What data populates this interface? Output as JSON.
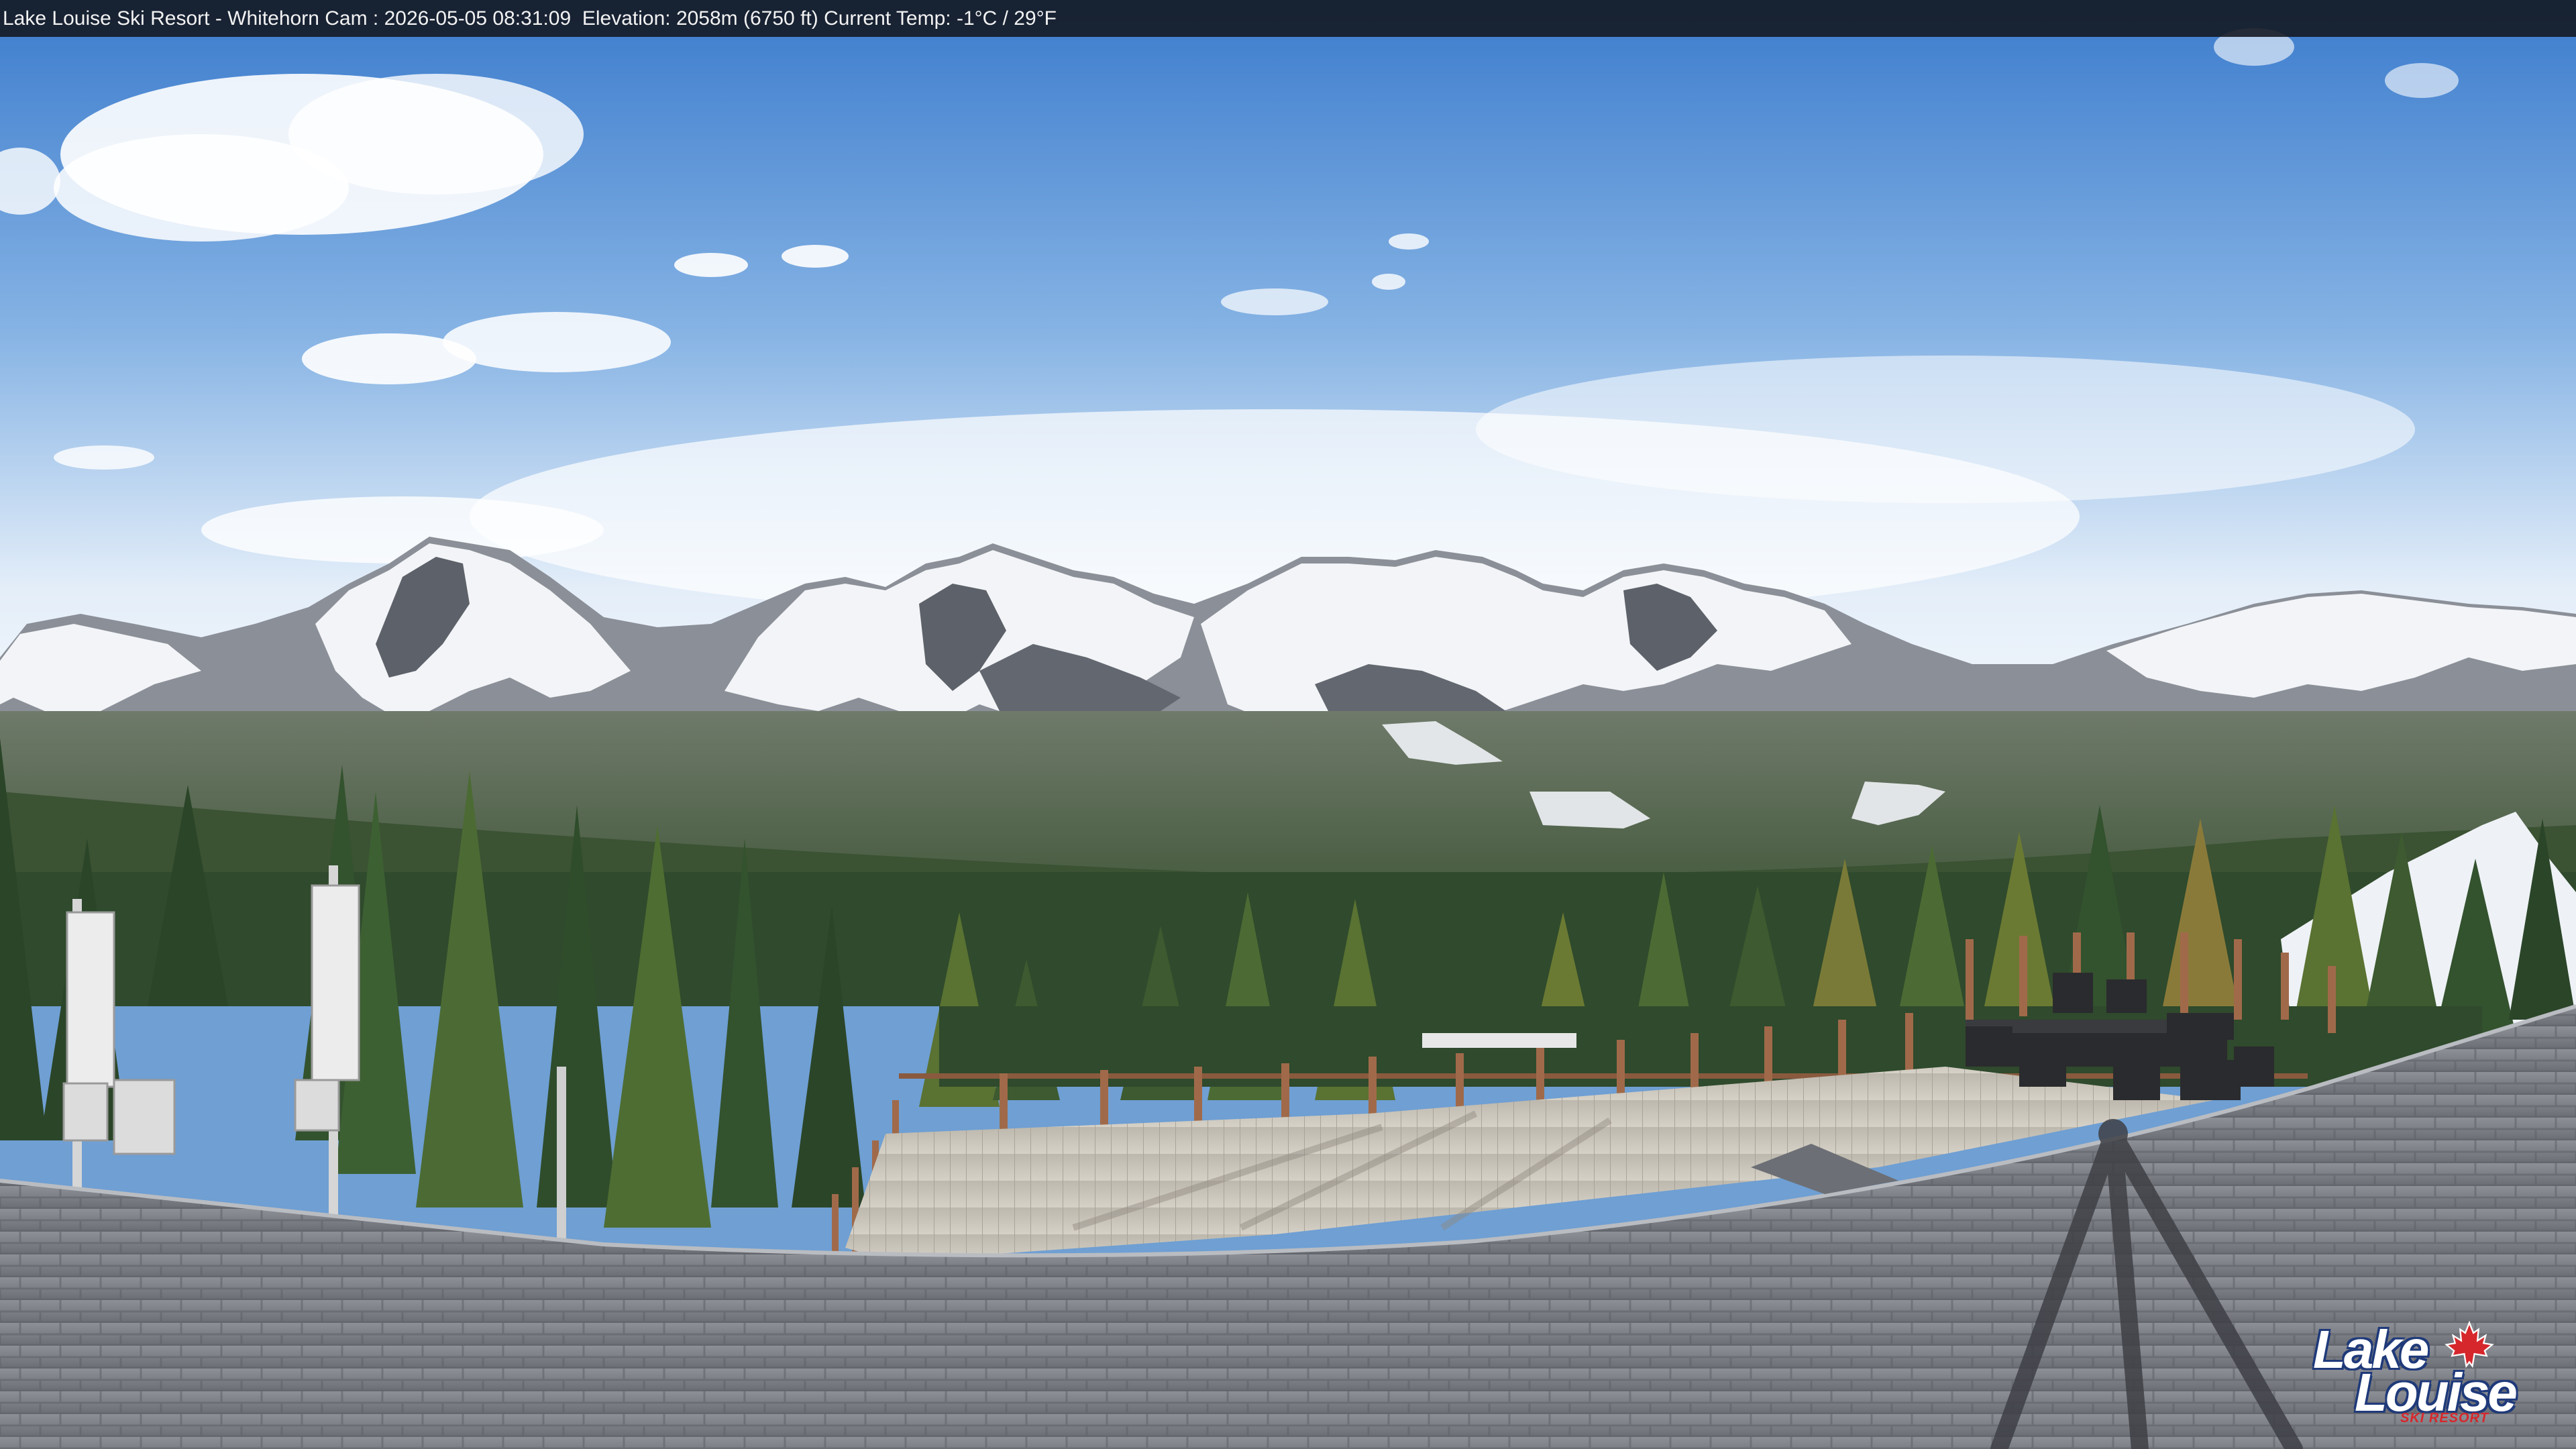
{
  "overlay": {
    "resort": "Lake Louise Ski Resort",
    "separator1": " - ",
    "camera": "Whitehorn Cam",
    "separator2": " : ",
    "timestamp": "2026-05-05 08:31:09",
    "elevation_label": "Elevation:",
    "elevation_value": "2058m (6750 ft)",
    "temp_label": "Current Temp:",
    "temp_value": "-1°C / 29°F"
  },
  "logo": {
    "line1": "Lake",
    "line2": "Louise",
    "tagline": "SKI RESORT"
  },
  "colors": {
    "sky_top": "#3f7fcf",
    "sky_horizon": "#eef4fb",
    "snow": "#f4f6f8",
    "rock": "#6e7178",
    "forest": "#2f4a2c",
    "deck": "#c9c4ba",
    "roof": "#7b7f86",
    "logo_red": "#d6272c",
    "logo_blue": "#1f3a7a"
  }
}
